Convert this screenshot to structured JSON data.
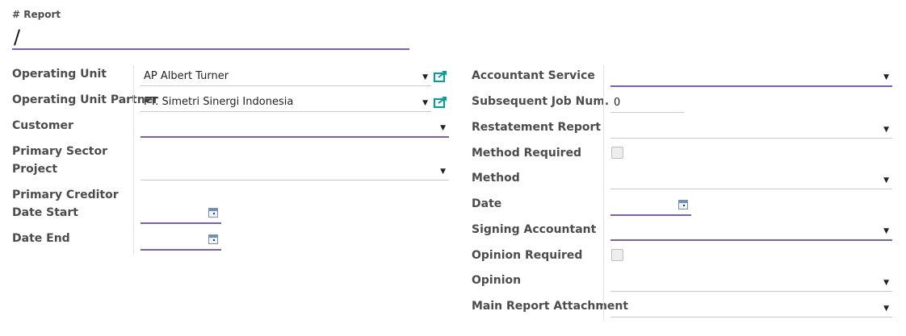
{
  "report": {
    "label": "# Report",
    "value": "/"
  },
  "left": {
    "operating_unit": {
      "label": "Operating Unit",
      "value": "AP Albert Turner"
    },
    "operating_unit_partner": {
      "label": "Operating Unit Partner",
      "value": "PT. Simetri Sinergi Indonesia"
    },
    "customer": {
      "label": "Customer",
      "value": ""
    },
    "primary_sector": {
      "label": "Primary Sector"
    },
    "project": {
      "label": "Project",
      "value": ""
    },
    "primary_creditor": {
      "label": "Primary Creditor"
    },
    "date_start": {
      "label": "Date Start",
      "value": ""
    },
    "date_end": {
      "label": "Date End",
      "value": ""
    }
  },
  "right": {
    "accountant_service": {
      "label": "Accountant Service",
      "value": ""
    },
    "subsequent_job_num": {
      "label": "Subsequent Job Num.",
      "value": "0"
    },
    "restatement_report": {
      "label": "Restatement Report",
      "value": ""
    },
    "method_required": {
      "label": "Method Required",
      "checked": false
    },
    "method": {
      "label": "Method",
      "value": ""
    },
    "date": {
      "label": "Date",
      "value": ""
    },
    "signing_accountant": {
      "label": "Signing Accountant",
      "value": ""
    },
    "opinion_required": {
      "label": "Opinion Required",
      "checked": false
    },
    "opinion": {
      "label": "Opinion",
      "value": ""
    },
    "main_report_attachment": {
      "label": "Main Report Attachment",
      "value": ""
    }
  },
  "icons": {
    "dropdown": "caret-down-icon",
    "external": "external-link-icon",
    "calendar": "calendar-icon"
  },
  "colors": {
    "accent": "#7c5dba",
    "link_icon": "#00a09d"
  }
}
